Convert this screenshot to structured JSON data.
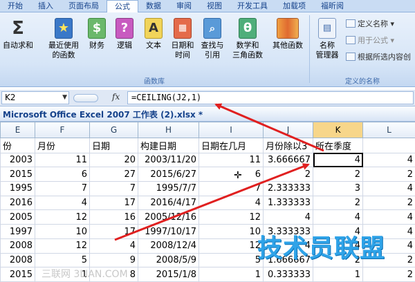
{
  "tabs": [
    "开始",
    "插入",
    "页面布局",
    "公式",
    "数据",
    "审阅",
    "视图",
    "开发工具",
    "加载项",
    "福昕阅"
  ],
  "active_tab_index": 3,
  "ribbon": {
    "function_library": {
      "buttons": [
        {
          "icon": "sigma-icon",
          "line1": "自动求和",
          "line2": ""
        },
        {
          "icon": "star-book-icon",
          "line1": "最近使用",
          "line2": "的函数"
        },
        {
          "icon": "finance-book-icon",
          "line1": "财务",
          "line2": ""
        },
        {
          "icon": "logic-book-icon",
          "line1": "逻辑",
          "line2": ""
        },
        {
          "icon": "text-book-icon",
          "line1": "文本",
          "line2": ""
        },
        {
          "icon": "datetime-book-icon",
          "line1": "日期和",
          "line2": "时间"
        },
        {
          "icon": "lookup-book-icon",
          "line1": "查找与",
          "line2": "引用"
        },
        {
          "icon": "math-book-icon",
          "line1": "数学和",
          "line2": "三角函数"
        },
        {
          "icon": "other-books-icon",
          "line1": "其他函数",
          "line2": ""
        }
      ],
      "label": "函数库"
    },
    "defined_names": {
      "name_manager_line1": "名称",
      "name_manager_line2": "管理器",
      "define_name": "定义名称",
      "use_in_formula": "用于公式",
      "create_from_selection": "根据所选内容创",
      "label": "定义的名称"
    }
  },
  "formula_bar": {
    "name_box": "K2",
    "fx": "fx",
    "formula": "=CEILING(J2,1)"
  },
  "workbook_title": "Microsoft Office Excel 2007 工作表 (2).xlsx *",
  "grid": {
    "columns": [
      "E",
      "F",
      "G",
      "H",
      "I",
      "J",
      "K",
      "L"
    ],
    "selected_column": "K",
    "headers": [
      "份",
      "月份",
      "日期",
      "构建日期",
      "日期在几月",
      "月份除以3",
      "所在季度",
      ""
    ],
    "rows": [
      [
        "2003",
        "11",
        "20",
        "2003/11/20",
        "11",
        "3.666667",
        "4",
        "4"
      ],
      [
        "2015",
        "6",
        "27",
        "2015/6/27",
        "6",
        "2",
        "2",
        "2"
      ],
      [
        "1995",
        "7",
        "7",
        "1995/7/7",
        "7",
        "2.333333",
        "3",
        "4"
      ],
      [
        "2016",
        "4",
        "17",
        "2016/4/17",
        "4",
        "1.333333",
        "2",
        "2"
      ],
      [
        "2005",
        "12",
        "16",
        "2005/12/16",
        "12",
        "4",
        "4",
        "4"
      ],
      [
        "1997",
        "10",
        "17",
        "1997/10/17",
        "10",
        "3.333333",
        "4",
        "4"
      ],
      [
        "2008",
        "12",
        "4",
        "2008/12/4",
        "12",
        "4",
        "4",
        "4"
      ],
      [
        "2008",
        "5",
        "9",
        "2008/5/9",
        "5",
        "1.666667",
        "2",
        "2"
      ],
      [
        "2015",
        "1",
        "8",
        "2015/1/8",
        "1",
        "0.333333",
        "1",
        "2"
      ]
    ]
  },
  "watermarks": {
    "brand": "技术员联盟",
    "url": "www.jsgho.com",
    "site": "三联网 3LIAN.COM"
  },
  "colors": {
    "arrow": "#e02020",
    "ribbon_tab_text": "#15428b",
    "selected_column_header": "#f7d68a",
    "watermark": "#2fa3e8"
  }
}
